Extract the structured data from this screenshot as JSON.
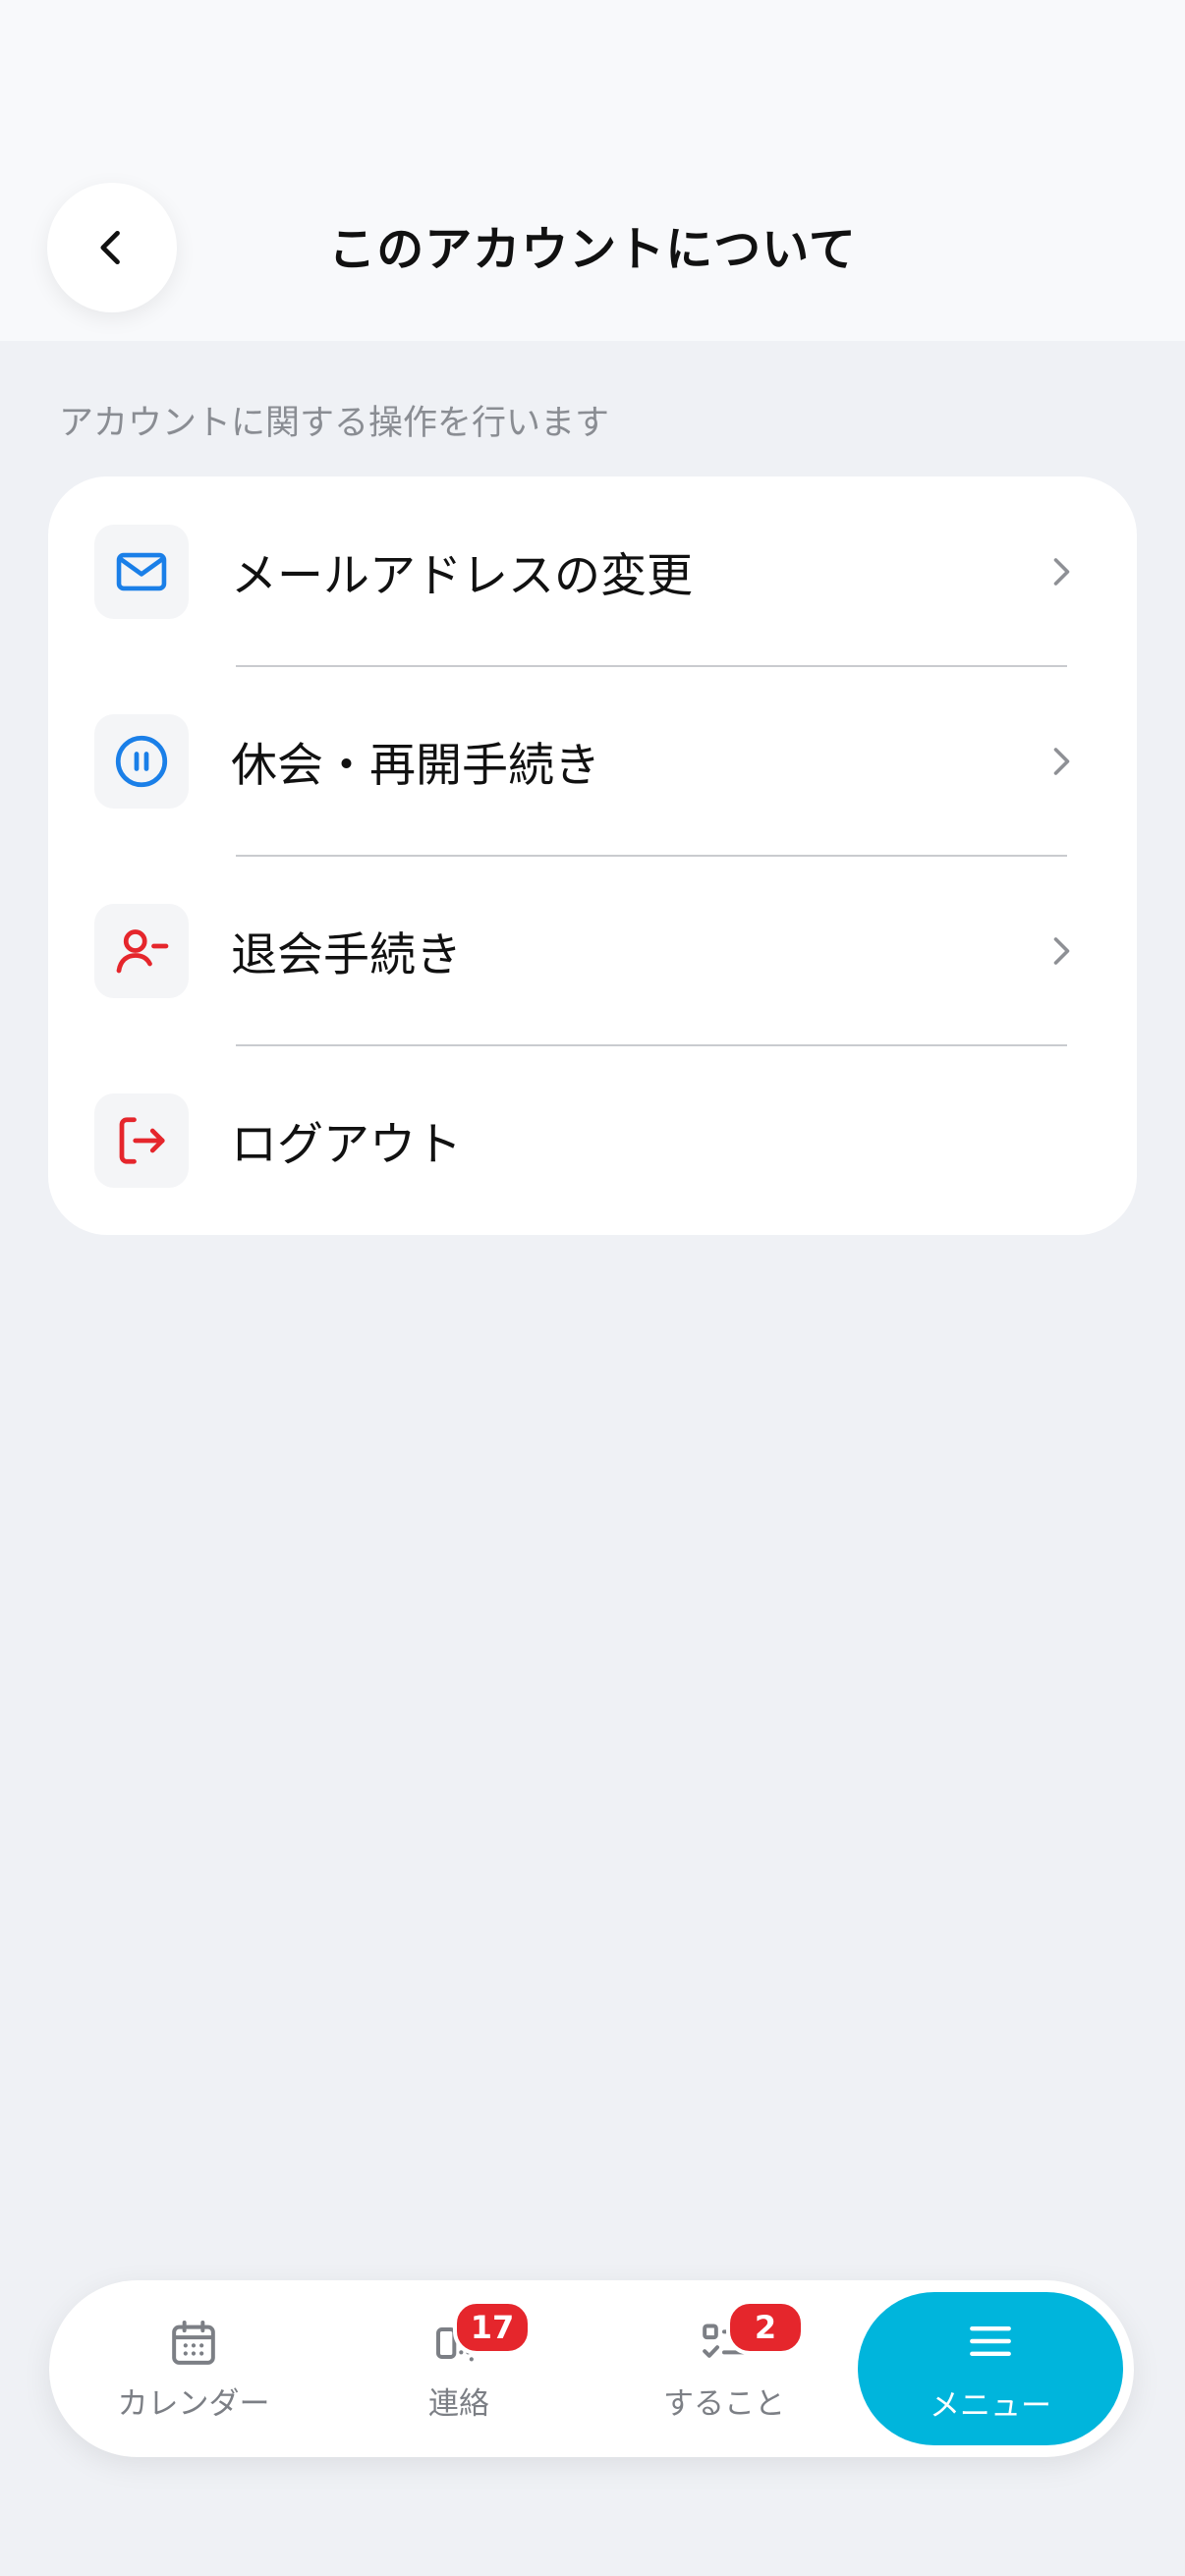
{
  "header": {
    "title": "このアカウントについて",
    "back_icon": "chevron-left-icon"
  },
  "caption": "アカウントに関する操作を行います",
  "menu": {
    "items": [
      {
        "label": "メールアドレスの変更",
        "icon": "mail-icon",
        "icon_color": "#1a7fe8",
        "has_chevron": true
      },
      {
        "label": "休会・再開手続き",
        "icon": "pause-circle-icon",
        "icon_color": "#1a7fe8",
        "has_chevron": true
      },
      {
        "label": "退会手続き",
        "icon": "user-minus-icon",
        "icon_color": "#e5262c",
        "has_chevron": true
      },
      {
        "label": "ログアウト",
        "icon": "logout-icon",
        "icon_color": "#e5262c",
        "has_chevron": false
      }
    ]
  },
  "bottom_nav": {
    "items": [
      {
        "label": "カレンダー",
        "icon": "calendar-icon",
        "badge": ""
      },
      {
        "label": "連絡",
        "icon": "message-icon",
        "badge": "17"
      },
      {
        "label": "すること",
        "icon": "checklist-icon",
        "badge": "2"
      },
      {
        "label": "メニュー",
        "icon": "hamburger-menu-icon",
        "badge": "",
        "active": true
      }
    ],
    "active_color": "#00b5dc",
    "badge_color": "#e5262c"
  }
}
